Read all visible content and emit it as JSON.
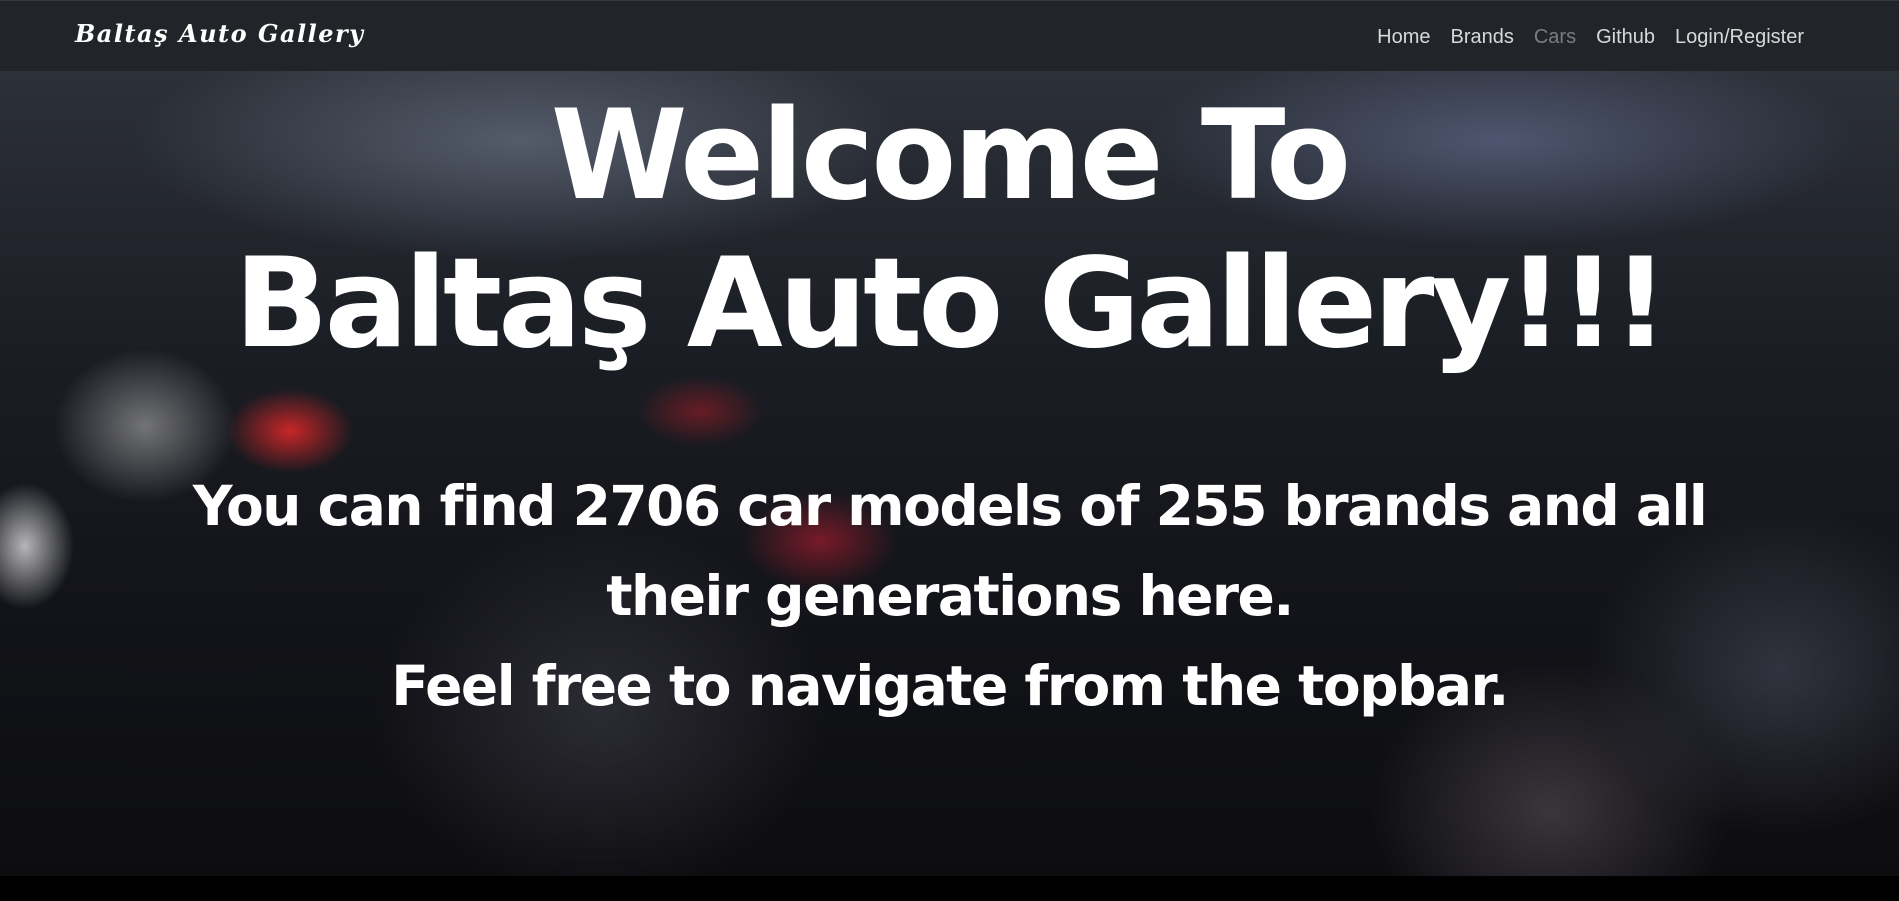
{
  "navbar": {
    "brand": "Baltaş Auto Gallery",
    "links": [
      {
        "label": "Home",
        "active": false
      },
      {
        "label": "Brands",
        "active": false
      },
      {
        "label": "Cars",
        "active": true
      },
      {
        "label": "Github",
        "active": false
      },
      {
        "label": "Login/Register",
        "active": false
      }
    ]
  },
  "hero": {
    "title_line1": "Welcome To",
    "title_line2": "Baltaş Auto Gallery!!!",
    "subtitle_line1": "You can find 2706 car models of 255 brands and all their generations here.",
    "subtitle_line2": "Feel free to navigate from the topbar."
  },
  "colors": {
    "navbar_bg": "#212529",
    "text": "#ffffff",
    "active_link": "rgba(255,255,255,0.40)"
  }
}
